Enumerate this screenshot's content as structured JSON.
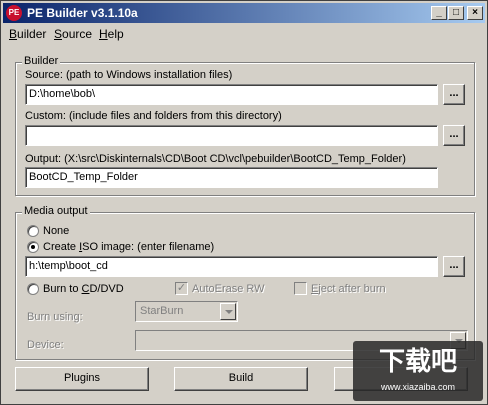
{
  "window": {
    "icon_text": "PE",
    "title": "PE Builder v3.1.10a",
    "minimize": "_",
    "maximize": "□",
    "close": "×"
  },
  "menu": {
    "items": [
      {
        "label": "Builder",
        "underline": "B",
        "rest": "uilder"
      },
      {
        "label": "Source",
        "underline": "S",
        "rest": "ource"
      },
      {
        "label": "Help",
        "underline": "H",
        "rest": "elp"
      }
    ]
  },
  "builder": {
    "group_label": "Builder",
    "source_label": "Source: (path to Windows installation files)",
    "source_value": "D:\\home\\bob\\",
    "custom_label": "Custom: (include files and folders from this directory)",
    "custom_value": "",
    "output_label": "Output: (X:\\src\\Diskinternals\\CD\\Boot CD\\vcl\\pebuilder\\BootCD_Temp_Folder)",
    "output_value": "BootCD_Temp_Folder",
    "browse_label": "..."
  },
  "media": {
    "group_label": "Media output",
    "none_label": "None",
    "iso_label_prefix": "Create ",
    "iso_label_u": "I",
    "iso_label_rest": "SO image: (enter filename)",
    "iso_value": "h:\\temp\\boot_cd",
    "burn_label_prefix": "Burn to ",
    "burn_label_u": "C",
    "burn_label_rest": "D/DVD",
    "autoerase_label": "AutoErase RW",
    "eject_label_u": "E",
    "eject_label_rest": "ject after burn",
    "burn_using_label": "Burn using:",
    "burn_using_value": "StarBurn",
    "device_label": "Device:",
    "device_value": "",
    "selected": "iso",
    "autoerase_checked": true,
    "eject_checked": false
  },
  "buttons": {
    "plugins": "Plugins",
    "build": "Build"
  },
  "watermark": {
    "text": "下载吧",
    "sub": "www.xiazaiba.com"
  }
}
